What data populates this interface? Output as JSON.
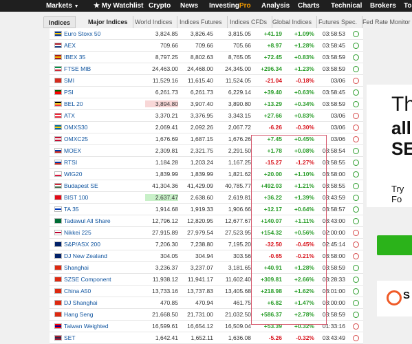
{
  "topnav": {
    "markets": "Markets",
    "markets_caret": "▼",
    "watchlist": "★ My Watchlist",
    "crypto": "Crypto",
    "news": "News",
    "investing": "Investing",
    "pro": "Pro",
    "analysis": "Analysis",
    "charts": "Charts",
    "technical": "Technical",
    "brokers": "Brokers",
    "tools": "To"
  },
  "subtabs": [
    "Indices",
    "Major Indices",
    "World Indices",
    "Indices Futures",
    "Indices CFDs",
    "Global Indices",
    "Futures Spec.",
    "Fed Rate Monitor T"
  ],
  "rows": [
    {
      "name": "Euro Stoxx 50",
      "last": "3,824.85",
      "high": "3,826.45",
      "low": "3,815.05",
      "chg": "+41.19",
      "pct": "+1.09%",
      "time": "03:58:53",
      "dir": "pos",
      "open": true,
      "colors": [
        "#003399",
        "#ffcc00",
        "#003399"
      ]
    },
    {
      "name": "AEX",
      "last": "709.66",
      "high": "709.66",
      "low": "705.66",
      "chg": "+8.97",
      "pct": "+1.28%",
      "time": "03:58:45",
      "dir": "pos",
      "open": true,
      "colors": [
        "#ae1c28",
        "#ffffff",
        "#21468b"
      ]
    },
    {
      "name": "IBEX 35",
      "last": "8,797.25",
      "high": "8,802.63",
      "low": "8,765.05",
      "chg": "+72.45",
      "pct": "+0.83%",
      "time": "03:58:59",
      "dir": "pos",
      "open": true,
      "colors": [
        "#aa151b",
        "#f1bf00",
        "#aa151b"
      ]
    },
    {
      "name": "FTSE MIB",
      "last": "24,463.00",
      "high": "24,468.00",
      "low": "24,345.00",
      "chg": "+296.34",
      "pct": "+1.23%",
      "time": "03:58:59",
      "dir": "pos",
      "open": true,
      "colors": [
        "#009246",
        "#ffffff",
        "#ce2b37"
      ]
    },
    {
      "name": "SMI",
      "last": "11,529.16",
      "high": "11,615.40",
      "low": "11,524.05",
      "chg": "-21.04",
      "pct": "-0.18%",
      "time": "03/06",
      "dir": "neg",
      "open": false,
      "colors": [
        "#d52b1e",
        "#d52b1e",
        "#d52b1e"
      ]
    },
    {
      "name": "PSI",
      "last": "6,261.73",
      "high": "6,261.73",
      "low": "6,229.14",
      "chg": "+39.40",
      "pct": "+0.63%",
      "time": "03:58:45",
      "dir": "pos",
      "open": true,
      "colors": [
        "#006600",
        "#ff0000",
        "#ff0000"
      ]
    },
    {
      "name": "BEL 20",
      "last": "3,894.80",
      "high": "3,907.40",
      "low": "3,890.80",
      "chg": "+13.29",
      "pct": "+0.34%",
      "time": "03:58:59",
      "dir": "pos",
      "open": true,
      "colors": [
        "#000000",
        "#fdda24",
        "#ef3340"
      ],
      "hl": "red"
    },
    {
      "name": "ATX",
      "last": "3,370.21",
      "high": "3,376.95",
      "low": "3,343.15",
      "chg": "+27.66",
      "pct": "+0.83%",
      "time": "03/06",
      "dir": "pos",
      "open": false,
      "colors": [
        "#ed2939",
        "#ffffff",
        "#ed2939"
      ]
    },
    {
      "name": "OMXS30",
      "last": "2,069.41",
      "high": "2,092.26",
      "low": "2,067.72",
      "chg": "-6.26",
      "pct": "-0.30%",
      "time": "03/06",
      "dir": "neg",
      "open": false,
      "colors": [
        "#006aa7",
        "#fecc00",
        "#006aa7"
      ]
    },
    {
      "name": "OMXC25",
      "last": "1,676.69",
      "high": "1,687.15",
      "low": "1,676.26",
      "chg": "+7.45",
      "pct": "+0.45%",
      "time": "03/06",
      "dir": "pos",
      "open": false,
      "colors": [
        "#c60c30",
        "#ffffff",
        "#c60c30"
      ]
    },
    {
      "name": "MOEX",
      "last": "2,309.81",
      "high": "2,321.75",
      "low": "2,291.50",
      "chg": "+1.78",
      "pct": "+0.08%",
      "time": "03:58:54",
      "dir": "pos",
      "open": true,
      "colors": [
        "#ffffff",
        "#0039a6",
        "#d52b1e"
      ]
    },
    {
      "name": "RTSI",
      "last": "1,184.28",
      "high": "1,203.24",
      "low": "1,167.25",
      "chg": "-15.27",
      "pct": "-1.27%",
      "time": "03:58:55",
      "dir": "neg",
      "open": true,
      "colors": [
        "#ffffff",
        "#0039a6",
        "#d52b1e"
      ]
    },
    {
      "name": "WIG20",
      "last": "1,839.99",
      "high": "1,839.99",
      "low": "1,821.62",
      "chg": "+20.00",
      "pct": "+1.10%",
      "time": "03:58:00",
      "dir": "pos",
      "open": true,
      "colors": [
        "#ffffff",
        "#ffffff",
        "#dc143c"
      ]
    },
    {
      "name": "Budapest SE",
      "last": "41,304.36",
      "high": "41,429.09",
      "low": "40,785.77",
      "chg": "+492.03",
      "pct": "+1.21%",
      "time": "03:58:55",
      "dir": "pos",
      "open": true,
      "colors": [
        "#ce2939",
        "#ffffff",
        "#477050"
      ]
    },
    {
      "name": "BIST 100",
      "last": "2,637.47",
      "high": "2,638.60",
      "low": "2,619.81",
      "chg": "+36.22",
      "pct": "+1.39%",
      "time": "03:43:59",
      "dir": "pos",
      "open": true,
      "colors": [
        "#e30a17",
        "#e30a17",
        "#e30a17"
      ],
      "hl": "green"
    },
    {
      "name": "TA 35",
      "last": "1,914.68",
      "high": "1,919.33",
      "low": "1,906.66",
      "chg": "+12.17",
      "pct": "+0.64%",
      "time": "03:58:57",
      "dir": "pos",
      "open": true,
      "colors": [
        "#ffffff",
        "#0038b8",
        "#ffffff"
      ]
    },
    {
      "name": "Tadawul All Share",
      "last": "12,796.12",
      "high": "12,820.95",
      "low": "12,677.67",
      "chg": "+140.07",
      "pct": "+1.11%",
      "time": "03:43:00",
      "dir": "pos",
      "open": true,
      "colors": [
        "#006c35",
        "#006c35",
        "#006c35"
      ]
    },
    {
      "name": "Nikkei 225",
      "last": "27,915.89",
      "high": "27,979.54",
      "low": "27,523.95",
      "chg": "+154.32",
      "pct": "+0.56%",
      "time": "02:00:00",
      "dir": "pos",
      "open": false,
      "colors": [
        "#ffffff",
        "#bc002d",
        "#ffffff"
      ]
    },
    {
      "name": "S&P/ASX 200",
      "last": "7,206.30",
      "high": "7,238.80",
      "low": "7,195.20",
      "chg": "-32.50",
      "pct": "-0.45%",
      "time": "02:45:14",
      "dir": "neg",
      "open": false,
      "colors": [
        "#012169",
        "#012169",
        "#012169"
      ]
    },
    {
      "name": "DJ New Zealand",
      "last": "304.05",
      "high": "304.94",
      "low": "303.56",
      "chg": "-0.65",
      "pct": "-0.21%",
      "time": "03:58:00",
      "dir": "neg",
      "open": false,
      "colors": [
        "#012169",
        "#012169",
        "#012169"
      ]
    },
    {
      "name": "Shanghai",
      "last": "3,236.37",
      "high": "3,237.07",
      "low": "3,181.65",
      "chg": "+40.91",
      "pct": "+1.28%",
      "time": "03:58:59",
      "dir": "pos",
      "open": true,
      "colors": [
        "#de2910",
        "#de2910",
        "#de2910"
      ]
    },
    {
      "name": "SZSE Component",
      "last": "11,938.12",
      "high": "11,941.17",
      "low": "11,602.40",
      "chg": "+309.81",
      "pct": "+2.66%",
      "time": "03:28:33",
      "dir": "pos",
      "open": true,
      "colors": [
        "#de2910",
        "#de2910",
        "#de2910"
      ]
    },
    {
      "name": "China A50",
      "last": "13,733.16",
      "high": "13,737.83",
      "low": "13,405.68",
      "chg": "+218.98",
      "pct": "+1.62%",
      "time": "03:01:00",
      "dir": "pos",
      "open": true,
      "colors": [
        "#de2910",
        "#de2910",
        "#de2910"
      ]
    },
    {
      "name": "DJ Shanghai",
      "last": "470.85",
      "high": "470.94",
      "low": "461.75",
      "chg": "+6.82",
      "pct": "+1.47%",
      "time": "03:00:00",
      "dir": "pos",
      "open": true,
      "colors": [
        "#de2910",
        "#de2910",
        "#de2910"
      ]
    },
    {
      "name": "Hang Seng",
      "last": "21,668.50",
      "high": "21,731.00",
      "low": "21,032.50",
      "chg": "+586.37",
      "pct": "+2.78%",
      "time": "03:58:59",
      "dir": "pos",
      "open": true,
      "colors": [
        "#de2910",
        "#de2910",
        "#de2910"
      ]
    },
    {
      "name": "Taiwan Weighted",
      "last": "16,599.61",
      "high": "16,654.12",
      "low": "16,509.04",
      "chg": "+53.39",
      "pct": "+0.32%",
      "time": "01:33:16",
      "dir": "pos",
      "open": false,
      "colors": [
        "#fe0000",
        "#000095",
        "#fe0000"
      ]
    },
    {
      "name": "SET",
      "last": "1,642.41",
      "high": "1,652.11",
      "low": "1,636.08",
      "chg": "-5.26",
      "pct": "-0.32%",
      "time": "03:43:49",
      "dir": "neg",
      "open": false,
      "colors": [
        "#a51931",
        "#2d2a4a",
        "#a51931"
      ]
    }
  ],
  "ad": {
    "t1": "Th",
    "t2": "all",
    "t3": "SE",
    "t4": "Try Fo"
  },
  "logo": {
    "letter": "S"
  }
}
